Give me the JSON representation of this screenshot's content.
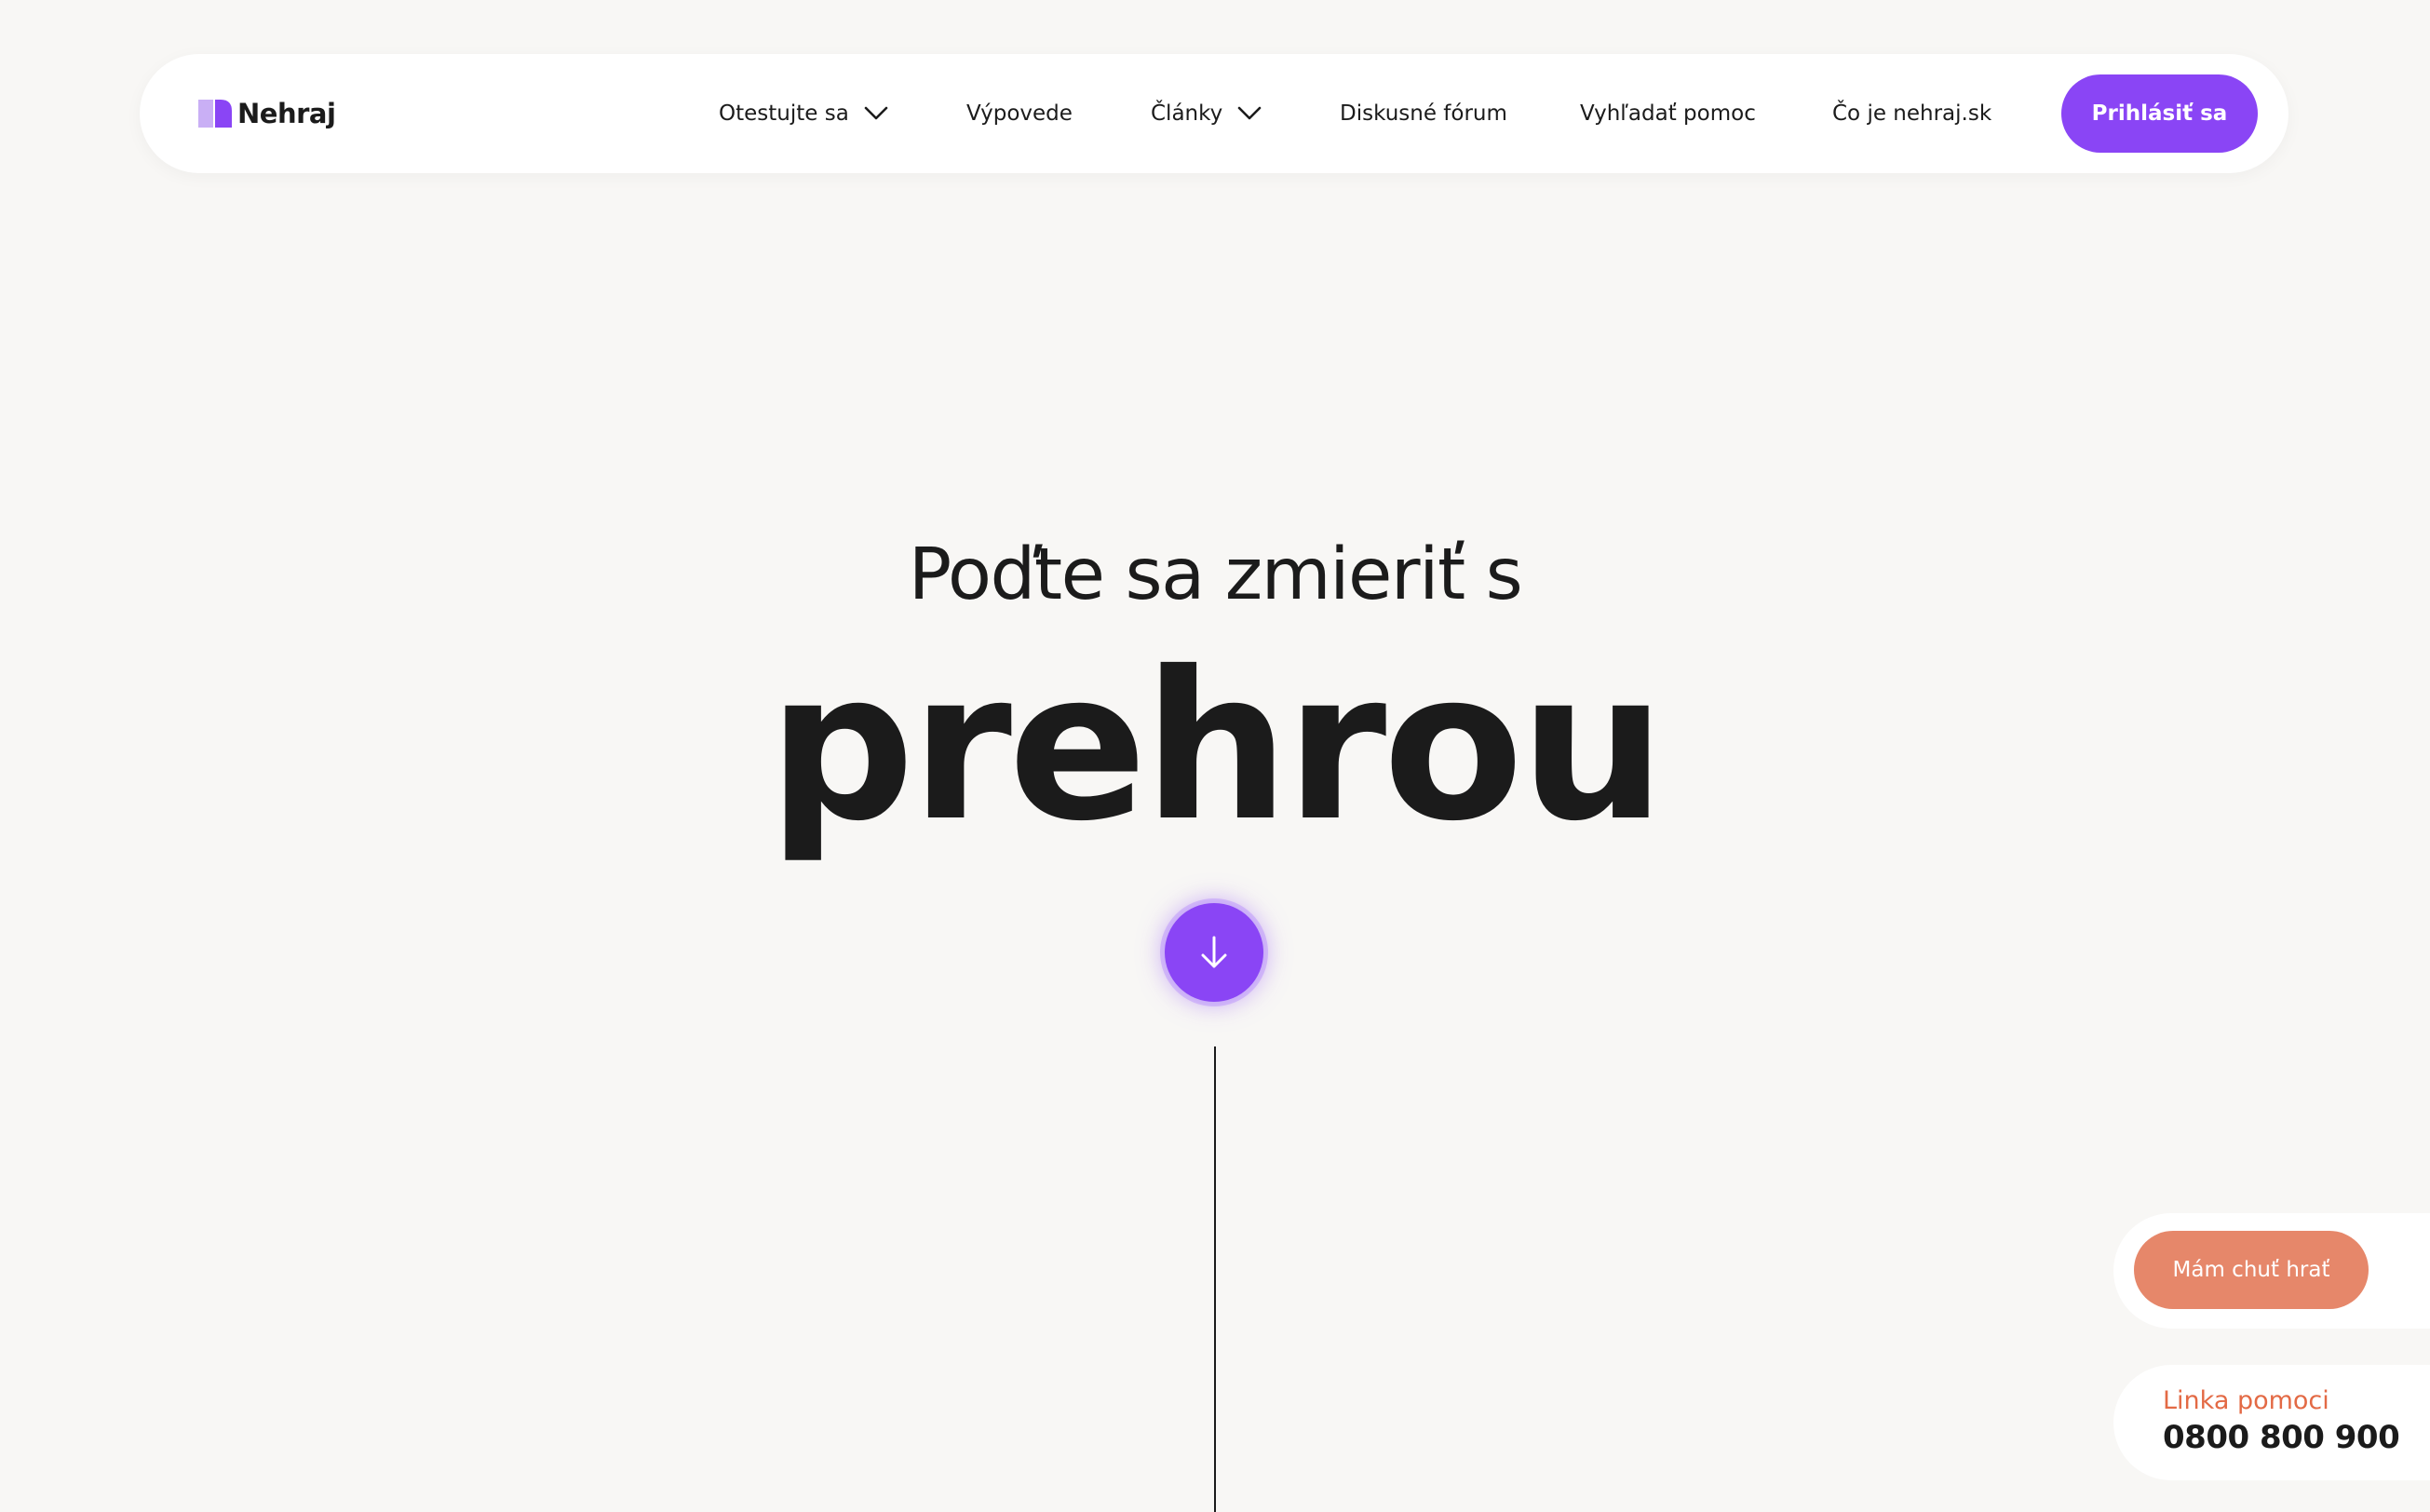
{
  "brand": {
    "name": "Nehraj",
    "logo_icon": "nehraj-logo-icon",
    "colors": {
      "accent": "#8a45f5",
      "logo_light": "#c9aff5",
      "secondary": "#e6876a",
      "help_label": "#e36a45",
      "background": "#f8f7f5",
      "text": "#1b1b1b"
    }
  },
  "nav": {
    "items": [
      {
        "label": "Otestujte sa",
        "has_dropdown": true,
        "icon": "chevron-down-icon"
      },
      {
        "label": "Výpovede",
        "has_dropdown": false
      },
      {
        "label": "Články",
        "has_dropdown": true,
        "icon": "chevron-down-icon"
      },
      {
        "label": "Diskusné fórum",
        "has_dropdown": false
      },
      {
        "label": "Vyhľadať pomoc",
        "has_dropdown": false
      },
      {
        "label": "Čo je nehraj.sk",
        "has_dropdown": false
      }
    ],
    "login_label": "Prihlásiť sa"
  },
  "hero": {
    "subtitle": "Poďte sa zmieriť s",
    "title": "prehrou",
    "scroll_icon": "arrow-down-icon"
  },
  "widgets": {
    "play_button_label": "Mám chuť hrať",
    "help_label": "Linka pomoci",
    "help_number": "0800 800 900"
  }
}
